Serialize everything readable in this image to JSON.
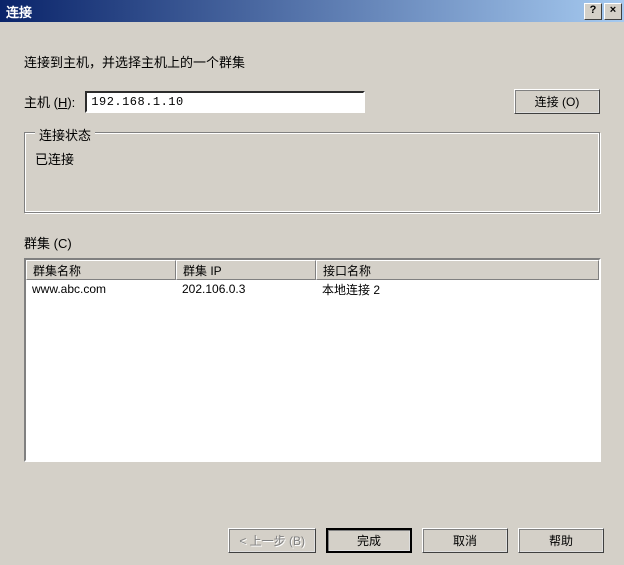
{
  "titlebar": {
    "title": "连接",
    "help": "?",
    "close": "×"
  },
  "instruction": "连接到主机，并选择主机上的一个群集",
  "host": {
    "label_pre": "主机 (",
    "label_hotkey": "H",
    "label_post": "):",
    "value": "192.168.1.10"
  },
  "connect_btn": {
    "label": "连接 (O)"
  },
  "status": {
    "legend": "连接状态",
    "text": "已连接"
  },
  "clusters": {
    "label": "群集 (C)",
    "headers": {
      "name": "群集名称",
      "ip": "群集 IP",
      "iface": "接口名称"
    },
    "rows": [
      {
        "name": "www.abc.com",
        "ip": "202.106.0.3",
        "iface": "本地连接 2"
      }
    ]
  },
  "buttons": {
    "back": "< 上一步 (B)",
    "finish": "完成",
    "cancel": "取消",
    "help": "帮助"
  }
}
